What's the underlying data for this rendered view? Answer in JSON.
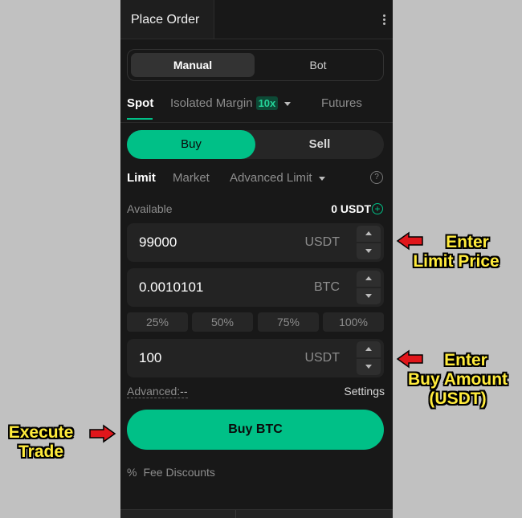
{
  "header": {
    "tab_label": "Place Order"
  },
  "mode": {
    "manual": "Manual",
    "bot": "Bot"
  },
  "market_tabs": {
    "spot": "Spot",
    "isolated_margin": "Isolated Margin",
    "leverage": "10x",
    "futures": "Futures"
  },
  "side": {
    "buy": "Buy",
    "sell": "Sell"
  },
  "order_types": {
    "limit": "Limit",
    "market": "Market",
    "advanced_limit": "Advanced Limit"
  },
  "available": {
    "label": "Available",
    "value": "0 USDT"
  },
  "price_field": {
    "value": "99000",
    "unit": "USDT"
  },
  "amount_field": {
    "value": "0.0010101",
    "unit": "BTC"
  },
  "percent_buttons": [
    "25%",
    "50%",
    "75%",
    "100%"
  ],
  "total_field": {
    "value": "100",
    "unit": "USDT"
  },
  "advanced": {
    "label": "Advanced:",
    "value": "--",
    "settings": "Settings"
  },
  "buy_button": "Buy BTC",
  "fee": {
    "label": "Fee Discounts"
  },
  "annotations": {
    "limit_price": [
      "Enter",
      "Limit Price"
    ],
    "buy_amount": [
      "Enter",
      "Buy Amount",
      "(USDT)"
    ],
    "execute": [
      "Execute",
      "Trade"
    ]
  },
  "colors": {
    "accent": "#00c087",
    "panel_bg": "#181818",
    "annotation_text": "#ffeb3b",
    "arrow": "#e0161b"
  }
}
